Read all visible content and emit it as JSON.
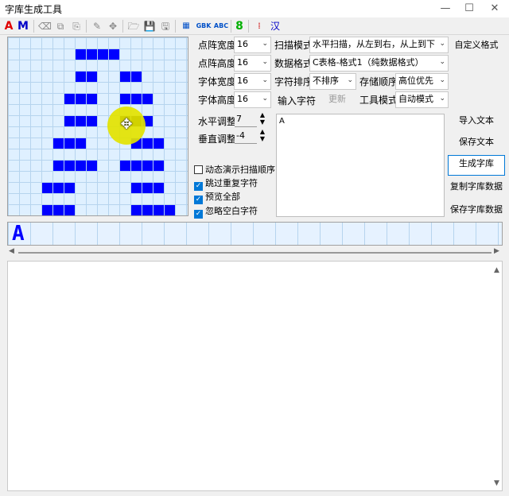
{
  "window": {
    "title": "字库生成工具"
  },
  "toolbar": {
    "font_a": "A",
    "font_m": "M",
    "gbk": "GBK",
    "abc": "ABC",
    "digit": "8",
    "han": "汉"
  },
  "settings": {
    "dot_width_label": "点阵宽度",
    "dot_width_value": "16",
    "dot_height_label": "点阵高度",
    "dot_height_value": "16",
    "font_width_label": "字体宽度",
    "font_width_value": "16",
    "font_height_label": "字体高度",
    "font_height_value": "16",
    "scan_mode_label": "扫描模式",
    "scan_mode_value": "水平扫描，从左到右，从上到下",
    "data_format_label": "数据格式",
    "data_format_value": "C表格-格式1（纯数据格式）",
    "char_sort_label": "字符排序",
    "char_sort_value": "不排序",
    "storage_order_label": "存储顺序",
    "storage_order_value": "高位优先",
    "input_char_label": "输入字符",
    "update_button": "更新",
    "tool_mode_label": "工具模式",
    "tool_mode_value": "自动模式",
    "h_adjust_label": "水平调整",
    "h_adjust_value": "7",
    "v_adjust_label": "垂直调整",
    "v_adjust_value": "-4"
  },
  "checkboxes": [
    {
      "label": "动态演示扫描顺序",
      "checked": false
    },
    {
      "label": "跳过重复字符",
      "checked": true
    },
    {
      "label": "预览全部",
      "checked": true
    },
    {
      "label": "忽略空白字符",
      "checked": true
    }
  ],
  "buttons": {
    "custom_format": "自定义格式",
    "import_text": "导入文本",
    "save_text": "保存文本",
    "generate_lib": "生成字库",
    "copy_lib_data": "复制字库数据",
    "save_lib_data": "保存字库数据"
  },
  "input_text": "A",
  "preview_char": "A",
  "glyph_bitmap": [
    "................",
    "......####......",
    "................",
    "......##..##....",
    "................",
    ".....###..###...",
    "................",
    ".....###..###...",
    "................",
    "....###....###..",
    "................",
    "....####..####..",
    "................",
    "...###.....###..",
    "................",
    "...###.....####."
  ],
  "colors": {
    "dot": "#0000ff",
    "grid_bg": "#dff0ff",
    "accent": "#0078d7"
  }
}
